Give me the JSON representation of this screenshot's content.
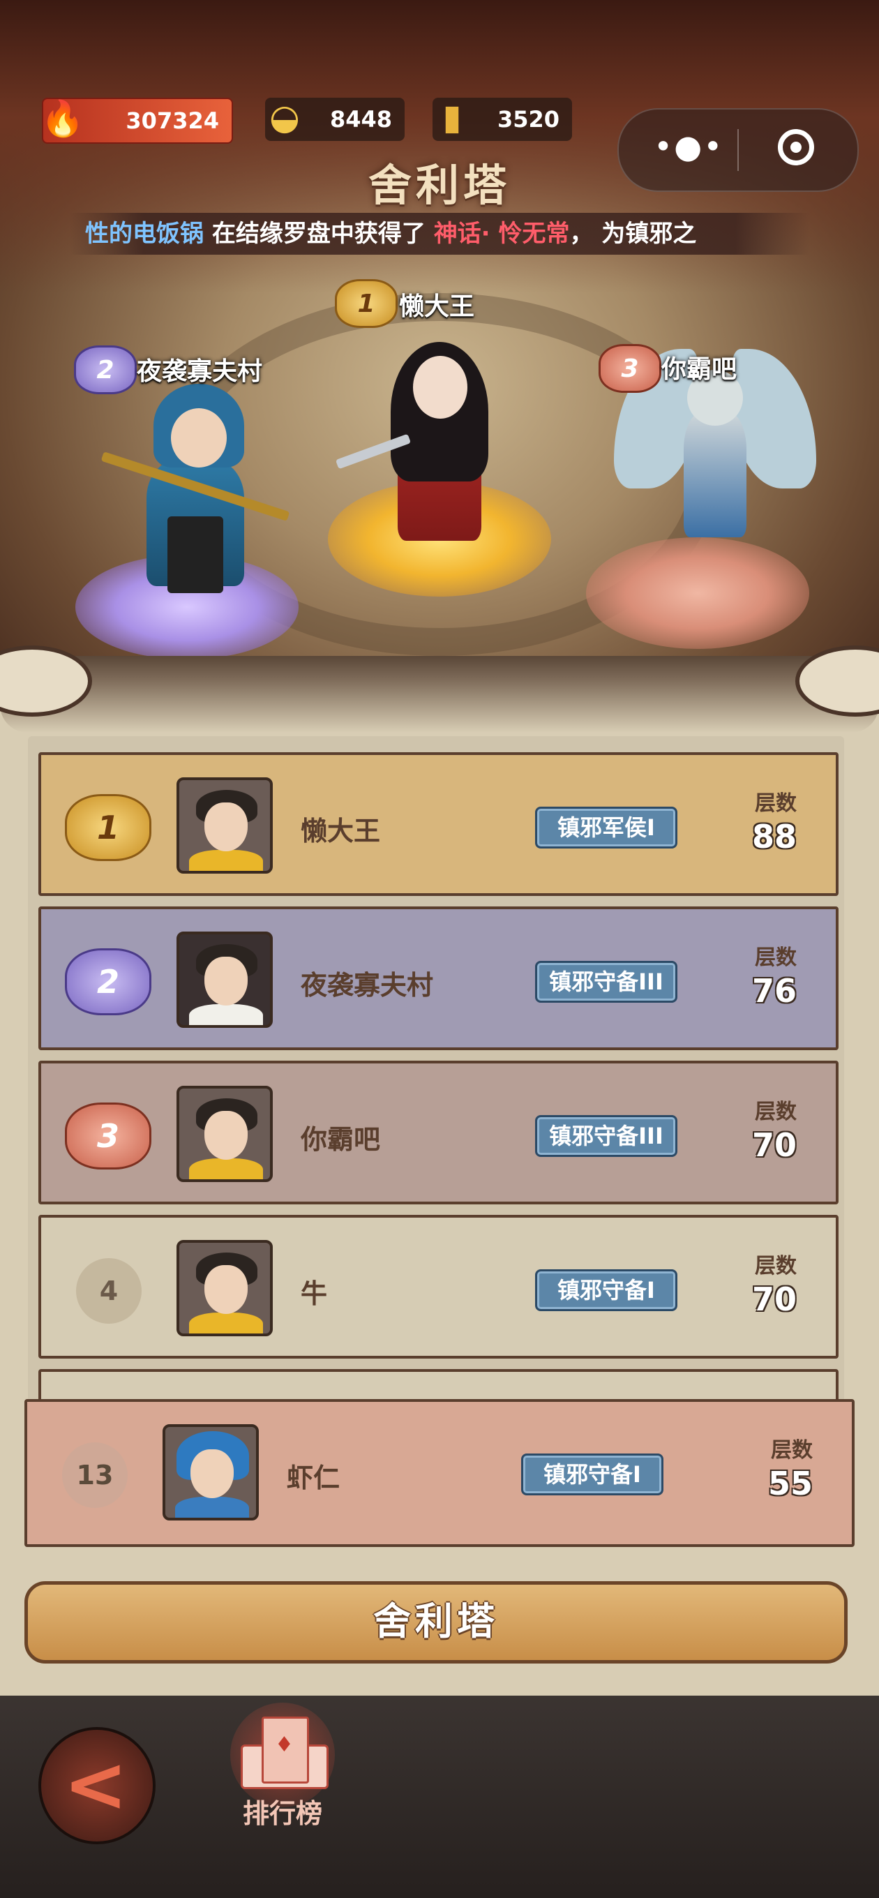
{
  "resources": {
    "flame": {
      "icon": "flame-icon",
      "value": "307324"
    },
    "gold": {
      "icon": "gold-ingot-icon",
      "value": "8448"
    },
    "ticket": {
      "icon": "card-ticket-icon",
      "value": "3520"
    }
  },
  "miniprogram_capsule": {
    "more_icon": "more-dots-icon",
    "close_icon": "target-close-icon"
  },
  "page_title": "舍利塔",
  "ticker": {
    "part1": "性的电饭锅",
    "part2": " 在结缘罗盘中获得了 ",
    "part3": "神话· 怜无常",
    "part4": "， 为镇邪之"
  },
  "podium": {
    "first": {
      "rank": "1",
      "name": "懒大王"
    },
    "second": {
      "rank": "2",
      "name": "夜袭寡夫村"
    },
    "third": {
      "rank": "3",
      "name": "你霸吧"
    }
  },
  "leaderboard": {
    "floors_label": "层数",
    "rows": [
      {
        "rank": "1",
        "name": "懒大王",
        "title": "镇邪军侯I",
        "floors": "88"
      },
      {
        "rank": "2",
        "name": "夜袭寡夫村",
        "title": "镇邪守备III",
        "floors": "76"
      },
      {
        "rank": "3",
        "name": "你霸吧",
        "title": "镇邪守备III",
        "floors": "70"
      },
      {
        "rank": "4",
        "name": "牛",
        "title": "镇邪守备I",
        "floors": "70"
      }
    ],
    "mine": {
      "rank": "13",
      "name": "虾仁",
      "title": "镇邪守备I",
      "floors": "55"
    }
  },
  "main_button": "舍利塔",
  "bottom_nav": {
    "back_icon": "back-arrow-icon",
    "ranking_label": "排行榜",
    "ranking_icon": "ranking-podium-icon"
  },
  "colors": {
    "gold": "#d8b67c",
    "purple": "#a09bb3",
    "red": "#b79f96",
    "badge": "#5c86a8",
    "accent_red": "#e8623b"
  }
}
